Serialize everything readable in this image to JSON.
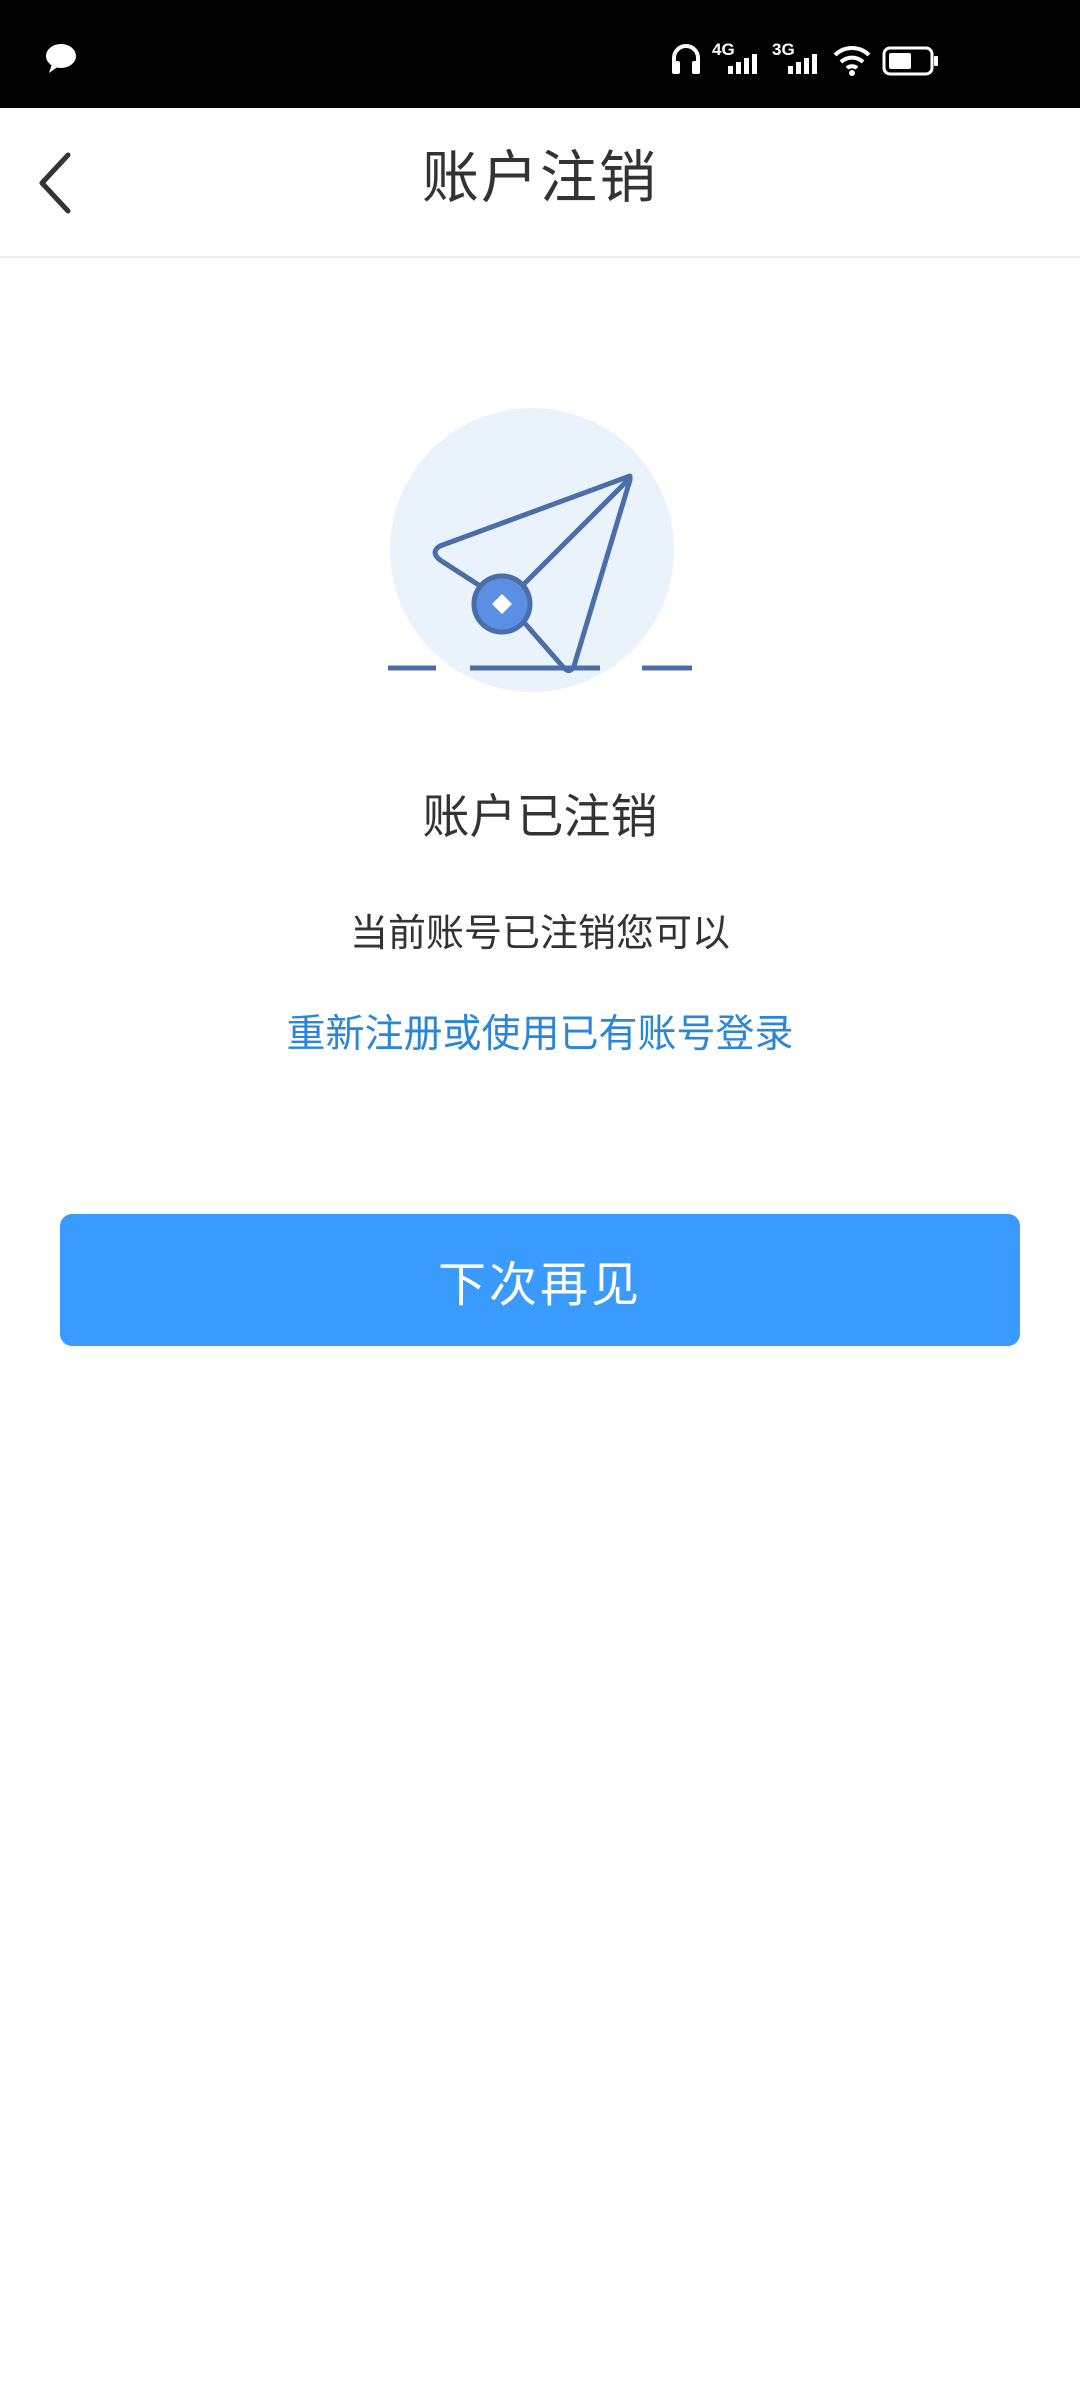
{
  "status_bar": {
    "network_1": "4G",
    "network_2": "3G",
    "icons": [
      "chat-icon",
      "headset-icon",
      "signal-icon",
      "wifi-icon",
      "battery-icon"
    ]
  },
  "header": {
    "title": "账户注销"
  },
  "main": {
    "illustration": "paper-plane-icon",
    "heading": "账户已注销",
    "description": "当前账号已注销您可以",
    "link_text": "重新注册或使用已有账号登录",
    "button_label": "下次再见"
  },
  "colors": {
    "accent": "#3a9bff",
    "link": "#2a86d8",
    "illustration_bg": "#eaf3fc",
    "illustration_stroke": "#4a6fa8"
  }
}
